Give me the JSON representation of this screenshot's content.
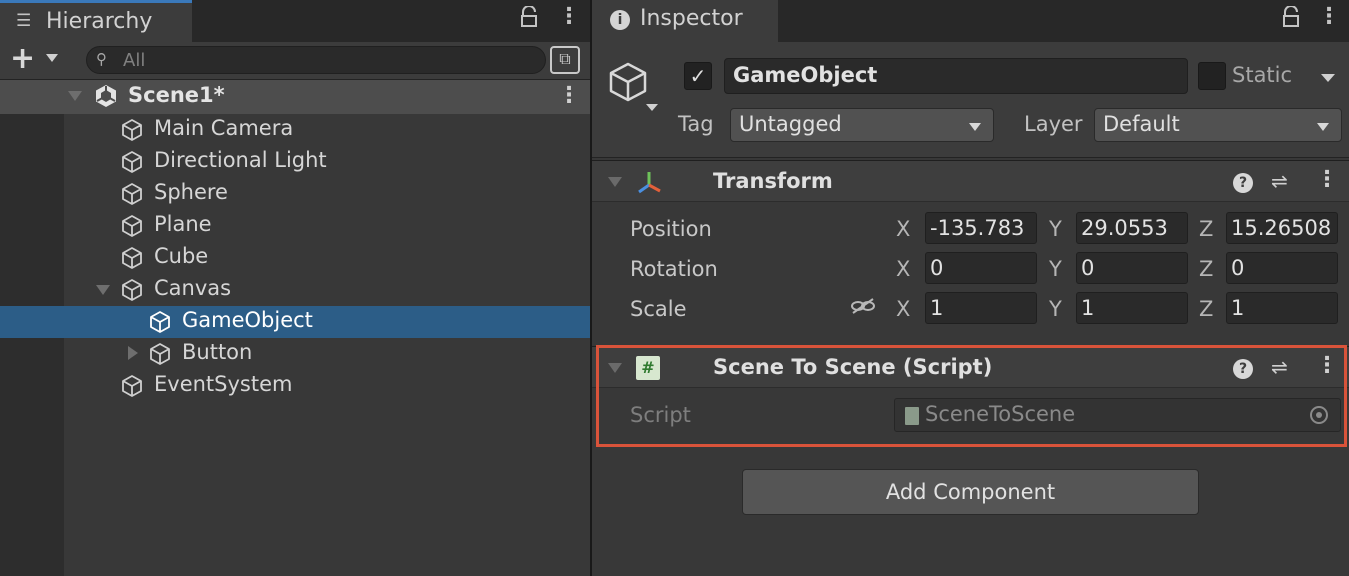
{
  "hierarchy": {
    "tab_label": "Hierarchy",
    "search_placeholder": "All",
    "scene": {
      "label": "Scene1*"
    },
    "items": [
      {
        "label": "Main Camera"
      },
      {
        "label": "Directional Light"
      },
      {
        "label": "Sphere"
      },
      {
        "label": "Plane"
      },
      {
        "label": "Cube"
      },
      {
        "label": "Canvas"
      },
      {
        "label": "GameObject"
      },
      {
        "label": "Button"
      },
      {
        "label": "EventSystem"
      }
    ]
  },
  "inspector": {
    "tab_label": "Inspector",
    "object": {
      "active": true,
      "name": "GameObject",
      "static_label": "Static",
      "static": false,
      "tag_label": "Tag",
      "tag_value": "Untagged",
      "layer_label": "Layer",
      "layer_value": "Default"
    },
    "transform": {
      "title": "Transform",
      "position": {
        "label": "Position",
        "x": "-135.783",
        "y": "29.0553",
        "z": "15.26508"
      },
      "rotation": {
        "label": "Rotation",
        "x": "0",
        "y": "0",
        "z": "0"
      },
      "scale": {
        "label": "Scale",
        "x": "1",
        "y": "1",
        "z": "1"
      },
      "axis_labels": {
        "x": "X",
        "y": "Y",
        "z": "Z"
      }
    },
    "script_component": {
      "title": "Scene To Scene (Script)",
      "script_label": "Script",
      "script_value": "SceneToScene"
    },
    "add_component_label": "Add Component"
  },
  "colors": {
    "selection": "#2c5d87",
    "highlight_border": "#d9533a",
    "tab_accent": "#3a79bb"
  }
}
